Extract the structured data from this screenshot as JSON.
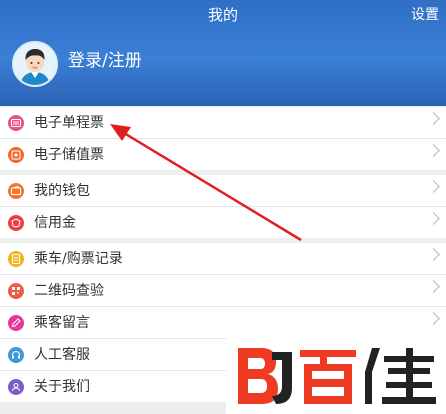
{
  "header": {
    "title": "我的",
    "settings_label": "设置",
    "login_label": "登录/注册"
  },
  "groups": [
    {
      "items": [
        {
          "label": "电子单程票",
          "icon": "ticket-icon",
          "color": "#e8508a"
        },
        {
          "label": "电子储值票",
          "icon": "stored-value-ticket-icon",
          "color": "#ef6a2c"
        }
      ]
    },
    {
      "items": [
        {
          "label": "我的钱包",
          "icon": "wallet-icon",
          "color": "#f0772f"
        },
        {
          "label": "信用金",
          "icon": "credit-icon",
          "color": "#ea3f44"
        }
      ]
    },
    {
      "items": [
        {
          "label": "乘车/购票记录",
          "icon": "record-icon",
          "color": "#efb51c"
        },
        {
          "label": "二维码查验",
          "icon": "qr-code-icon",
          "color": "#ec5d45"
        },
        {
          "label": "乘客留言",
          "icon": "message-icon",
          "color": "#e5379a"
        },
        {
          "label": "人工客服",
          "icon": "headset-icon",
          "color": "#3f9ad8"
        },
        {
          "label": "关于我们",
          "icon": "about-icon",
          "color": "#7a5cc9"
        }
      ]
    }
  ],
  "watermark": {
    "text": "百佳"
  }
}
